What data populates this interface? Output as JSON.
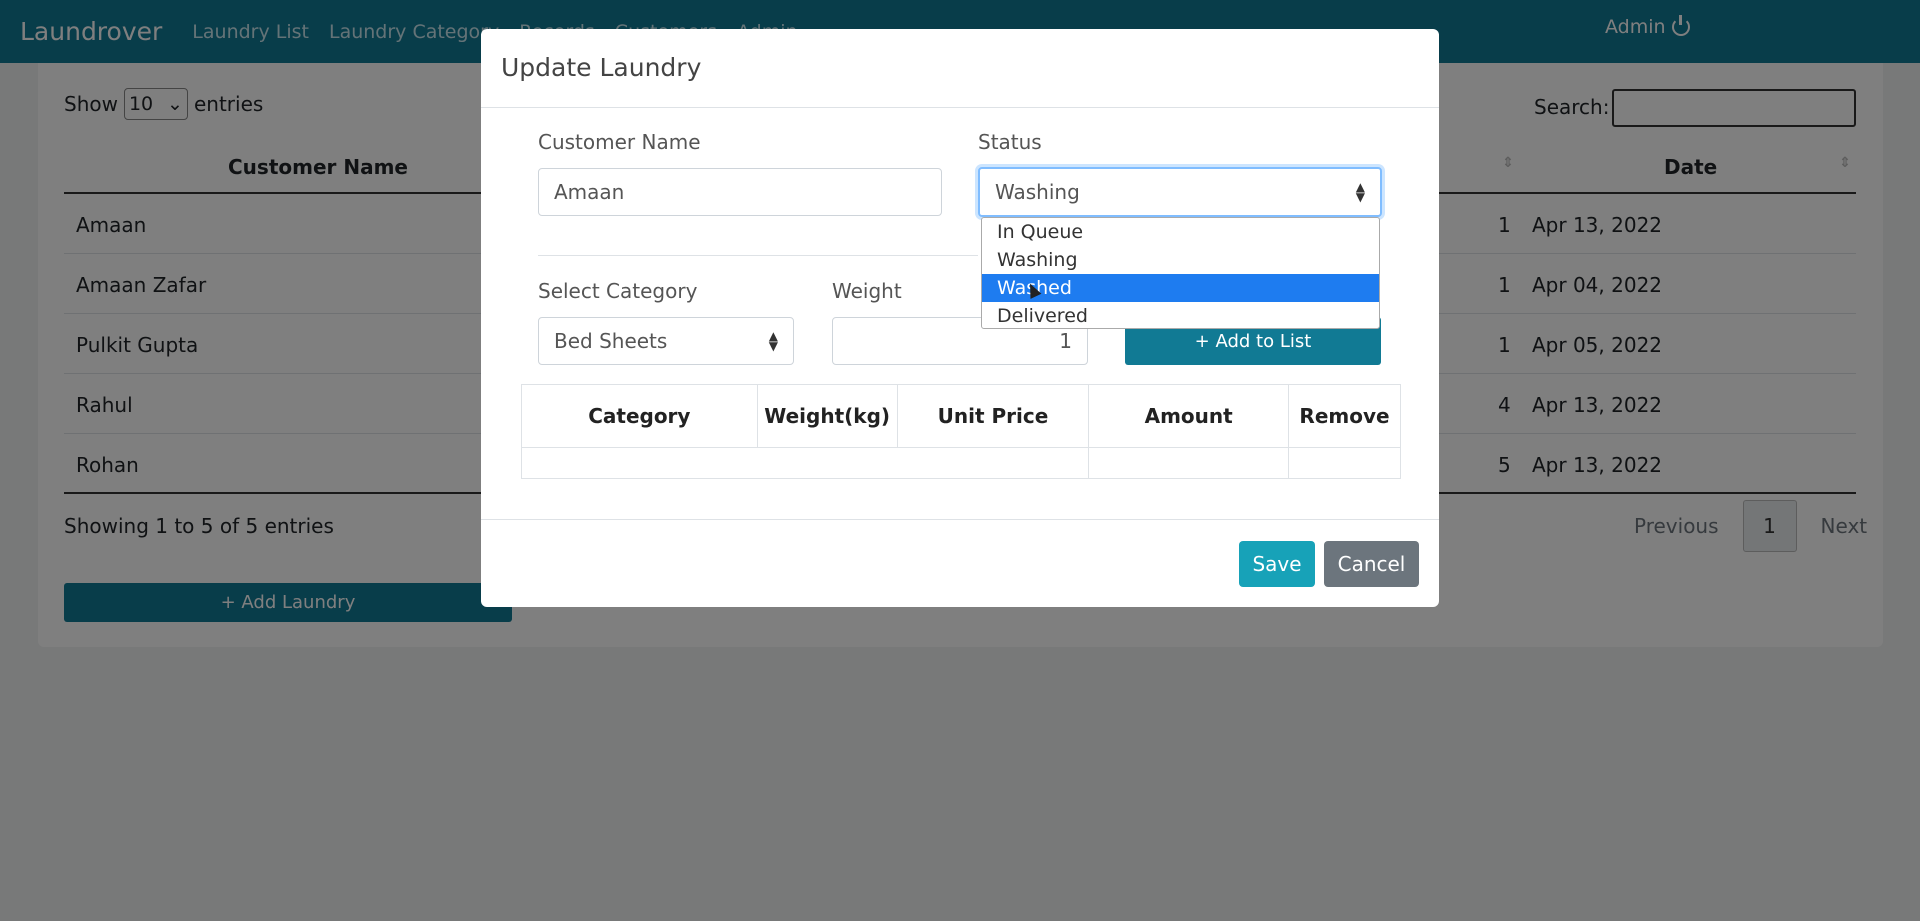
{
  "navbar": {
    "brand": "Laundrover",
    "links": [
      "Laundry List",
      "Laundry Category",
      "Records",
      "Customers",
      "Admin"
    ],
    "user": "Admin"
  },
  "list": {
    "show_label": "Show",
    "entries_label": "entries",
    "page_length": "10",
    "search_label": "Search:",
    "columns": {
      "customer": "Customer Name",
      "date": "Date"
    },
    "rows": [
      {
        "name": "Amaan",
        "qty": "1",
        "date": "Apr 13, 2022"
      },
      {
        "name": "Amaan Zafar",
        "qty": "1",
        "date": "Apr 04, 2022"
      },
      {
        "name": "Pulkit Gupta",
        "qty": "1",
        "date": "Apr 05, 2022"
      },
      {
        "name": "Rahul",
        "qty": "4",
        "date": "Apr 13, 2022"
      },
      {
        "name": "Rohan",
        "qty": "5",
        "date": "Apr 13, 2022"
      }
    ],
    "showing": "Showing 1 to 5 of 5 entries",
    "pagination": {
      "previous": "Previous",
      "current": "1",
      "next": "Next"
    },
    "add_button": "+ Add Laundry"
  },
  "modal": {
    "title": "Update Laundry",
    "customer_label": "Customer Name",
    "customer_value": "Amaan",
    "status_label": "Status",
    "status_value": "Washing",
    "status_options": [
      "In Queue",
      "Washing",
      "Washed",
      "Delivered"
    ],
    "highlighted_option": "Washed",
    "category_label": "Select Category",
    "category_value": "Bed Sheets",
    "weight_label": "Weight",
    "weight_value": "1",
    "add_to_list": "+ Add to List",
    "table_headers": [
      "Category",
      "Weight(kg)",
      "Unit Price",
      "Amount",
      "Remove"
    ],
    "save": "Save",
    "cancel": "Cancel"
  }
}
